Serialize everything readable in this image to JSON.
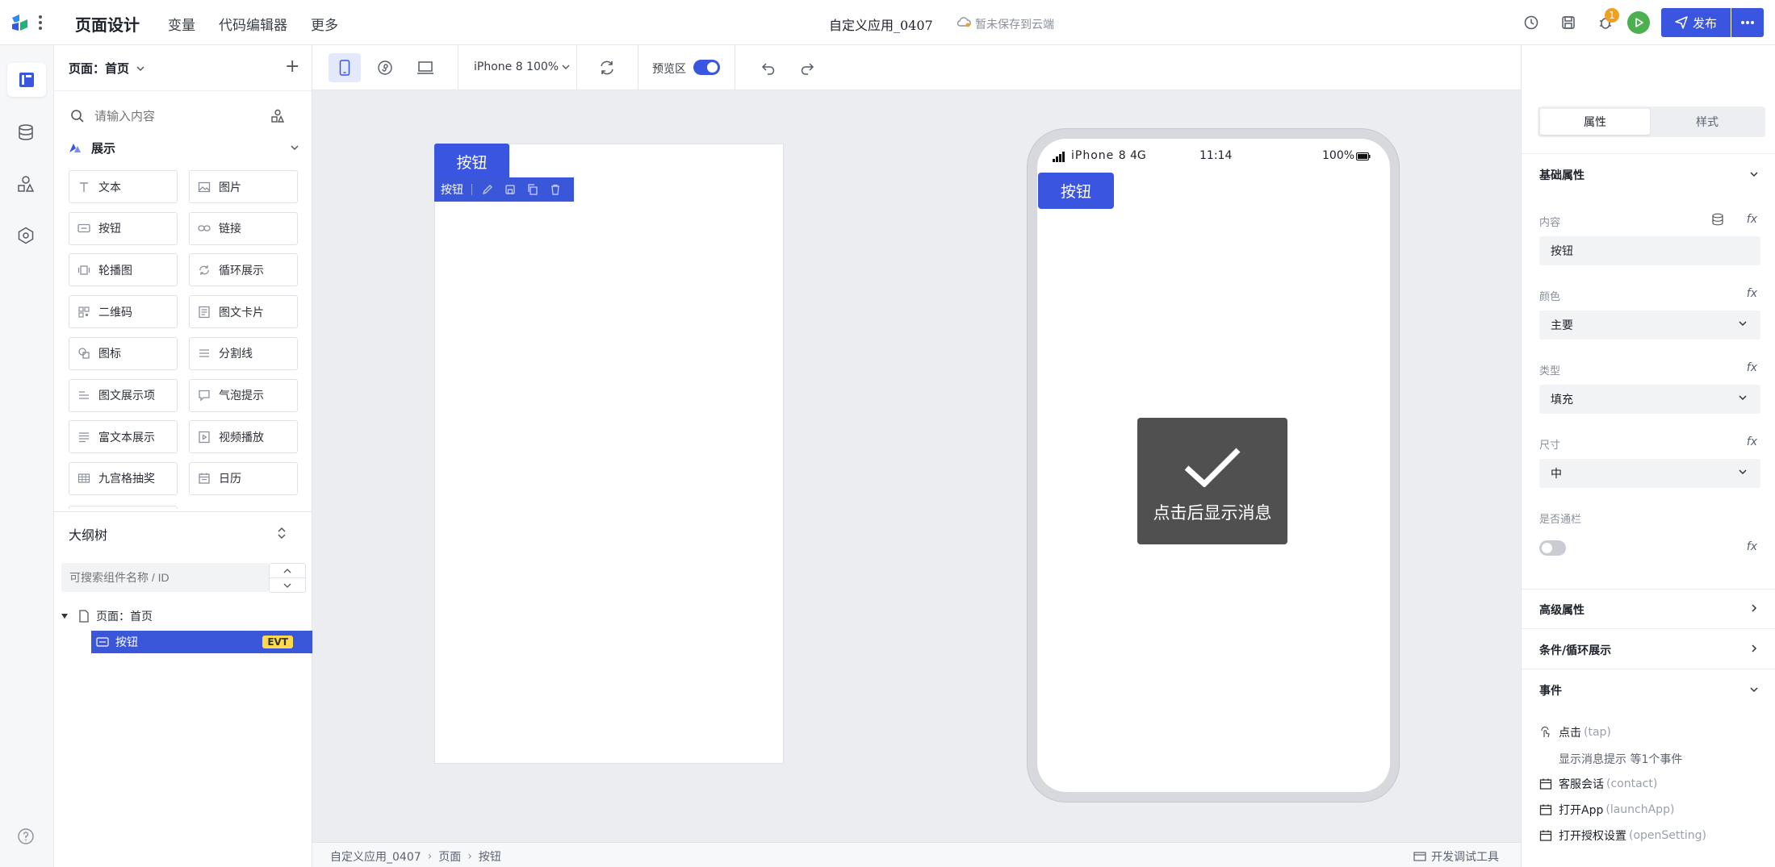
{
  "header": {
    "title": "页面设计",
    "nav": [
      "变量",
      "代码编辑器",
      "更多"
    ],
    "app_name": "自定义应用_0407",
    "save_status": "暂未保存到云端",
    "notification_count": "1",
    "publish_label": "发布"
  },
  "rail": {
    "icons": [
      "layout-icon",
      "database-icon",
      "shapes-icon",
      "settings-hex-icon",
      "help-icon"
    ]
  },
  "panel": {
    "page_selector": "页面：首页",
    "search_placeholder": "请输入内容",
    "category": "展示",
    "components": [
      {
        "label": "文本",
        "icon": "text-icon"
      },
      {
        "label": "图片",
        "icon": "image-icon"
      },
      {
        "label": "按钮",
        "icon": "button-icon"
      },
      {
        "label": "链接",
        "icon": "link-icon"
      },
      {
        "label": "轮播图",
        "icon": "carousel-icon"
      },
      {
        "label": "循环展示",
        "icon": "loop-icon"
      },
      {
        "label": "二维码",
        "icon": "qrcode-icon"
      },
      {
        "label": "图文卡片",
        "icon": "card-icon"
      },
      {
        "label": "图标",
        "icon": "icon-icon"
      },
      {
        "label": "分割线",
        "icon": "divider-icon"
      },
      {
        "label": "图文展示项",
        "icon": "list-item-icon"
      },
      {
        "label": "气泡提示",
        "icon": "bubble-icon"
      },
      {
        "label": "富文本展示",
        "icon": "richtext-icon"
      },
      {
        "label": "视频播放",
        "icon": "video-icon"
      },
      {
        "label": "九宫格抽奖",
        "icon": "grid-lottery-icon"
      },
      {
        "label": "日历",
        "icon": "calendar-icon"
      }
    ],
    "outline_title": "大纲树",
    "outline_search_placeholder": "可搜索组件名称 / ID",
    "tree": {
      "root": "页面：首页",
      "child": "按钮",
      "child_badge": "EVT"
    }
  },
  "toolbar": {
    "device_label": "iPhone 8 100%",
    "preview_label": "预览区",
    "preview_on": true
  },
  "canvas": {
    "selected_button_label": "按钮",
    "selection_tag": "按钮",
    "phone_carrier": "iPhone 8",
    "phone_network": "4G",
    "phone_time": "11:14",
    "phone_battery": "100%",
    "phone_button_label": "按钮",
    "toast_message": "点击后显示消息"
  },
  "statusbar": {
    "breadcrumb": [
      "自定义应用_0407",
      "页面",
      "按钮"
    ],
    "devtools_label": "开发调试工具"
  },
  "props": {
    "tabs": [
      "属性",
      "样式"
    ],
    "active_tab": "属性",
    "basic_section": "基础属性",
    "content_label": "内容",
    "content_value": "按钮",
    "color_label": "颜色",
    "color_value": "主要",
    "type_label": "类型",
    "type_value": "填充",
    "size_label": "尺寸",
    "size_value": "中",
    "block_label": "是否通栏",
    "block_on": false,
    "fx_label": "fx",
    "advanced_section": "高级属性",
    "condition_section": "条件/循环展示",
    "events_section": "事件",
    "events": [
      {
        "name": "点击",
        "en": "(tap)",
        "detail": "显示消息提示 等1个事件"
      },
      {
        "name": "客服会话",
        "en": "(contact)"
      },
      {
        "name": "打开App",
        "en": "(launchApp)"
      },
      {
        "name": "打开授权设置",
        "en": "(openSetting)"
      }
    ]
  },
  "colors": {
    "primary": "#3a55e0",
    "selection": "#3b57d9",
    "toast_bg": "#505050",
    "success_green": "#4caf50",
    "badge_orange": "#f0a020"
  }
}
